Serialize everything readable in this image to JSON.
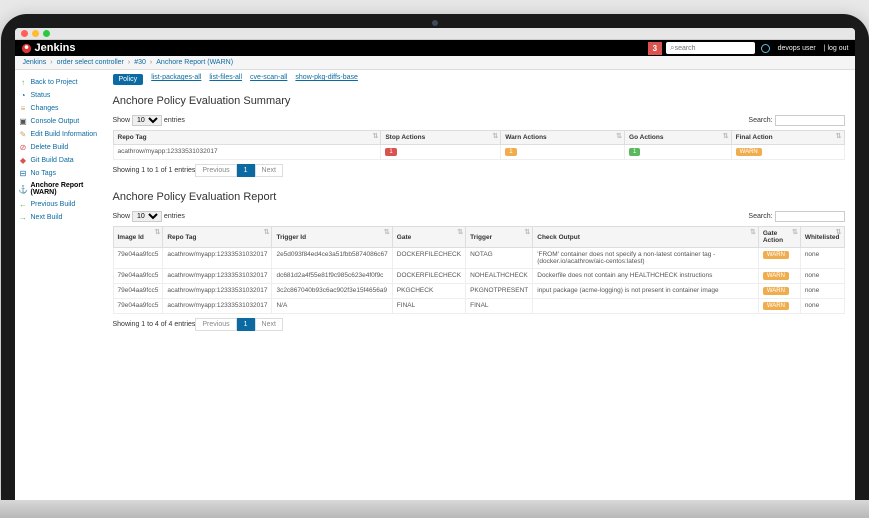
{
  "top": {
    "brand": "Jenkins",
    "notif_count": "3",
    "search_placeholder": "search",
    "user": "devops user",
    "logout": "log out"
  },
  "crumb": [
    "Jenkins",
    "order select controller",
    "#30",
    "Anchore Report (WARN)"
  ],
  "side": [
    {
      "icon": "↑",
      "color": "#5cb85c",
      "label": "Back to Project"
    },
    {
      "icon": "◔",
      "color": "#0b6aa2",
      "label": "Status"
    },
    {
      "icon": "≡",
      "color": "#c9a26b",
      "label": "Changes"
    },
    {
      "icon": "▣",
      "color": "#555",
      "label": "Console Output"
    },
    {
      "icon": "✎",
      "color": "#c9a26b",
      "label": "Edit Build Information"
    },
    {
      "icon": "⊘",
      "color": "#d9534f",
      "label": "Delete Build"
    },
    {
      "icon": "◆",
      "color": "#d9534f",
      "label": "Git Build Data"
    },
    {
      "icon": "⊟",
      "color": "#0b6aa2",
      "label": "No Tags"
    },
    {
      "icon": "⚓",
      "color": "#0b6aa2",
      "label": "Anchore Report (WARN)",
      "sel": true
    },
    {
      "icon": "←",
      "color": "#5cb85c",
      "label": "Previous Build"
    },
    {
      "icon": "→",
      "color": "#5cb85c",
      "label": "Next Build"
    }
  ],
  "tabs": [
    "Policy",
    "list-packages-all",
    "list-files-all",
    "cve-scan-all",
    "show-pkg-diffs-base"
  ],
  "summary": {
    "title": "Anchore Policy Evaluation Summary",
    "show_label": "Show",
    "entries_label": "entries",
    "entries_sel": "10",
    "search_label": "Search:",
    "cols": [
      "Repo Tag",
      "Stop Actions",
      "Warn Actions",
      "Go Actions",
      "Final Action"
    ],
    "rows": [
      {
        "repo": "acathrow/myapp:12333531032017",
        "stop": "1",
        "warn": "1",
        "go": "1",
        "final": "WARN"
      }
    ],
    "info": "Showing 1 to 1 of 1 entries",
    "prev": "Previous",
    "page": "1",
    "next": "Next"
  },
  "report": {
    "title": "Anchore Policy Evaluation Report",
    "show_label": "Show",
    "entries_label": "entries",
    "entries_sel": "10",
    "search_label": "Search:",
    "cols": [
      "Image Id",
      "Repo Tag",
      "Trigger Id",
      "Gate",
      "Trigger",
      "Check Output",
      "Gate Action",
      "Whitelisted"
    ],
    "rows": [
      {
        "img": "79e04aa9fcc5",
        "repo": "acathrow/myapp:12333531032017",
        "trig": "2e5d093f84ed4ce3a51fbb5874086c67",
        "gate": "DOCKERFILECHECK",
        "trigger": "NOTAG",
        "out": "'FROM' container does not specify a non-latest container tag - (docker.io/acathrow/aic-centos:latest)",
        "act": "WARN",
        "wl": "none"
      },
      {
        "img": "79e04aa9fcc5",
        "repo": "acathrow/myapp:12333531032017",
        "trig": "dc681d2a4f55e81f9c985c623e4f0f9c",
        "gate": "DOCKERFILECHECK",
        "trigger": "NOHEALTHCHECK",
        "out": "Dockerfile does not contain any HEALTHCHECK instructions",
        "act": "WARN",
        "wl": "none"
      },
      {
        "img": "79e04aa9fcc5",
        "repo": "acathrow/myapp:12333531032017",
        "trig": "3c2c867040b93c6ac902f3e15f4656a9",
        "gate": "PKGCHECK",
        "trigger": "PKGNOTPRESENT",
        "out": "input package (acme-logging) is not present in container image",
        "act": "WARN",
        "wl": "none"
      },
      {
        "img": "79e04aa9fcc5",
        "repo": "acathrow/myapp:12333531032017",
        "trig": "N/A",
        "gate": "FINAL",
        "trigger": "FINAL",
        "out": "",
        "act": "WARN",
        "wl": "none"
      }
    ],
    "info": "Showing 1 to 4 of 4 entries",
    "prev": "Previous",
    "page": "1",
    "next": "Next"
  }
}
